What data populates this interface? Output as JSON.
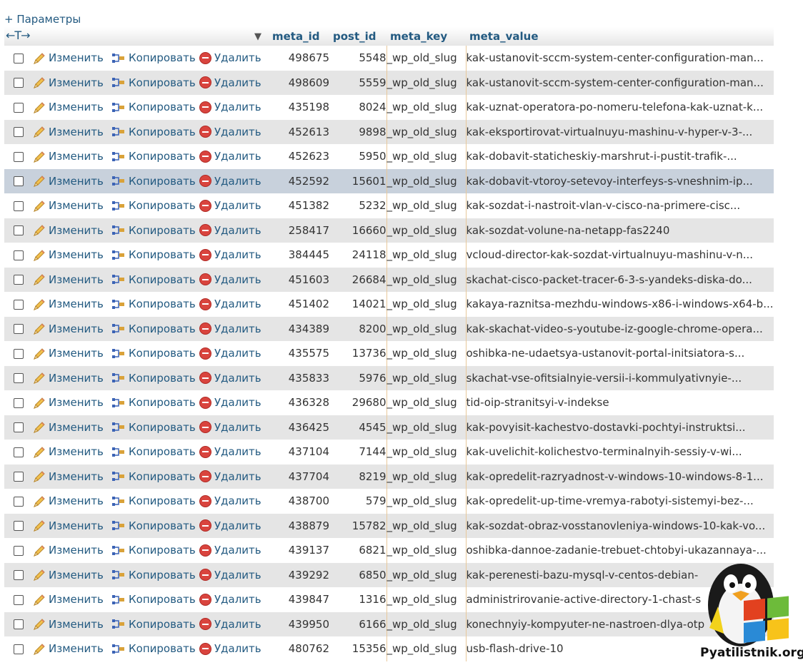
{
  "options_link": "+ Параметры",
  "header": {
    "arrows": "←T→",
    "sort_indicator": "▼",
    "columns": [
      "meta_id",
      "post_id",
      "meta_key",
      "meta_value"
    ]
  },
  "actions": {
    "edit": "Изменить",
    "copy": "Копировать",
    "delete": "Удалить"
  },
  "rows": [
    {
      "meta_id": "498675",
      "post_id": "5548",
      "meta_key": "_wp_old_slug",
      "meta_value": "kak-ustanovit-sccm-system-center-configuration-man..."
    },
    {
      "meta_id": "498609",
      "post_id": "5559",
      "meta_key": "_wp_old_slug",
      "meta_value": "kak-ustanovit-sccm-system-center-configuration-man..."
    },
    {
      "meta_id": "435198",
      "post_id": "8024",
      "meta_key": "_wp_old_slug",
      "meta_value": "kak-uznat-operatora-po-nomeru-telefona-kak-uznat-k..."
    },
    {
      "meta_id": "452613",
      "post_id": "9898",
      "meta_key": "_wp_old_slug",
      "meta_value": "kak-eksportirovat-virtualnuyu-mashinu-v-hyper-v-3-..."
    },
    {
      "meta_id": "452623",
      "post_id": "5950",
      "meta_key": "_wp_old_slug",
      "meta_value": "kak-dobavit-staticheskiy-marshrut-i-pustit-trafik-..."
    },
    {
      "meta_id": "452592",
      "post_id": "15601",
      "meta_key": "_wp_old_slug",
      "meta_value": "kak-dobavit-vtoroy-setevoy-interfeys-s-vneshnim-ip..."
    },
    {
      "meta_id": "451382",
      "post_id": "5232",
      "meta_key": "_wp_old_slug",
      "meta_value": "kak-sozdat-i-nastroit-vlan-v-cisco-na-primere-cisc..."
    },
    {
      "meta_id": "258417",
      "post_id": "16660",
      "meta_key": "_wp_old_slug",
      "meta_value": "kak-sozdat-volune-na-netapp-fas2240"
    },
    {
      "meta_id": "384445",
      "post_id": "24118",
      "meta_key": "_wp_old_slug",
      "meta_value": "vcloud-director-kak-sozdat-virtualnuyu-mashinu-v-n..."
    },
    {
      "meta_id": "451603",
      "post_id": "26684",
      "meta_key": "_wp_old_slug",
      "meta_value": "skachat-cisco-packet-tracer-6-3-s-yandeks-diska-do..."
    },
    {
      "meta_id": "451402",
      "post_id": "14021",
      "meta_key": "_wp_old_slug",
      "meta_value": "kakaya-raznitsa-mezhdu-windows-x86-i-windows-x64-b..."
    },
    {
      "meta_id": "434389",
      "post_id": "8200",
      "meta_key": "_wp_old_slug",
      "meta_value": "kak-skachat-video-s-youtube-iz-google-chrome-opera..."
    },
    {
      "meta_id": "435575",
      "post_id": "13736",
      "meta_key": "_wp_old_slug",
      "meta_value": "oshibka-ne-udaetsya-ustanovit-portal-initsiatora-s..."
    },
    {
      "meta_id": "435833",
      "post_id": "5976",
      "meta_key": "_wp_old_slug",
      "meta_value": "skachat-vse-ofitsialnyie-versii-i-kommulyativnyie-..."
    },
    {
      "meta_id": "436328",
      "post_id": "29680",
      "meta_key": "_wp_old_slug",
      "meta_value": "tid-oip-stranitsyi-v-indekse"
    },
    {
      "meta_id": "436425",
      "post_id": "4545",
      "meta_key": "_wp_old_slug",
      "meta_value": "kak-povyisit-kachestvo-dostavki-pochtyi-instruktsi..."
    },
    {
      "meta_id": "437104",
      "post_id": "7144",
      "meta_key": "_wp_old_slug",
      "meta_value": "kak-uvelichit-kolichestvo-terminalnyih-sessiy-v-wi..."
    },
    {
      "meta_id": "437704",
      "post_id": "8219",
      "meta_key": "_wp_old_slug",
      "meta_value": "kak-opredelit-razryadnost-v-windows-10-windows-8-1..."
    },
    {
      "meta_id": "438700",
      "post_id": "579",
      "meta_key": "_wp_old_slug",
      "meta_value": "kak-opredelit-up-time-vremya-rabotyi-sistemyi-bez-..."
    },
    {
      "meta_id": "438879",
      "post_id": "15782",
      "meta_key": "_wp_old_slug",
      "meta_value": "kak-sozdat-obraz-vosstanovleniya-windows-10-kak-vo..."
    },
    {
      "meta_id": "439137",
      "post_id": "6821",
      "meta_key": "_wp_old_slug",
      "meta_value": "oshibka-dannoe-zadanie-trebuet-chtobyi-ukazannaya-..."
    },
    {
      "meta_id": "439292",
      "post_id": "6850",
      "meta_key": "_wp_old_slug",
      "meta_value": "kak-perenesti-bazu-mysql-v-centos-debian-"
    },
    {
      "meta_id": "439847",
      "post_id": "1316",
      "meta_key": "_wp_old_slug",
      "meta_value": "administrirovanie-active-directory-1-chast-s"
    },
    {
      "meta_id": "439950",
      "post_id": "6166",
      "meta_key": "_wp_old_slug",
      "meta_value": "konechnyiy-kompyuter-ne-nastroen-dlya-otp"
    },
    {
      "meta_id": "480762",
      "post_id": "15356",
      "meta_key": "_wp_old_slug",
      "meta_value": "usb-flash-drive-10"
    }
  ],
  "highlighted_row_index": 5,
  "watermark": "Pyatilistnik.org",
  "colors": {
    "link": "#235a81",
    "row_even": "#e5e5e5",
    "row_marked": "#c8d1dc",
    "delete": "#d9443e"
  }
}
